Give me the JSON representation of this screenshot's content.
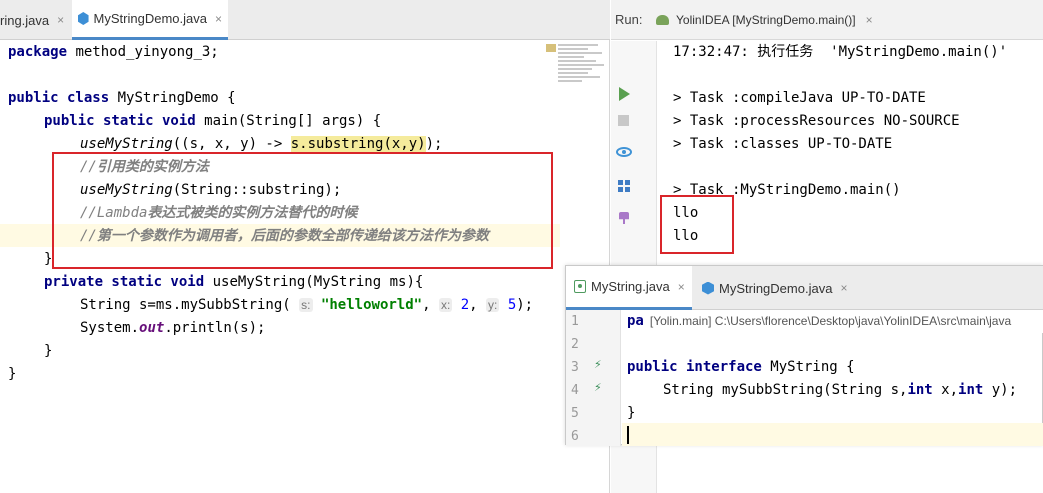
{
  "left_editor": {
    "tabs": [
      {
        "label": "ring.java",
        "close": "×"
      },
      {
        "label": "MyStringDemo.java",
        "close": "×"
      }
    ],
    "code": {
      "l1_kw": "package",
      "l1_rest": " method_yinyong_3;",
      "l3_kw": "public class",
      "l3_rest": " MyStringDemo {",
      "l4_kw": "public static void",
      "l4_rest": " main(String[] args) {",
      "l5_call": "useMyString",
      "l5_a": "((s, x, y) -> ",
      "l5_b": "s.substring(x,y)",
      "l5_c": ");",
      "l6_comment_a": "//",
      "l6_comment_b": "引用类的实例方法",
      "l7_call": "useMyString",
      "l7_rest": "(String::substring);",
      "l8_comment_a": "//Lambda",
      "l8_comment_b": "表达式被类的实例方法替代的时候",
      "l9_comment_a": "//",
      "l9_comment_b": "第一个参数作为调用者，后面的参数全部传递给该方法作为参数",
      "l10": "}",
      "l11_kw": "private static void",
      "l11_rest": " useMyString(MyString ms){",
      "l12_a": "String s=ms.mySubbString( ",
      "l12_hint_s": "s:",
      "l12_str": "\"helloworld\"",
      "l12_b": ", ",
      "l12_hint_x": "x:",
      "l12_num_x": "2",
      "l12_c": ", ",
      "l12_hint_y": "y:",
      "l12_num_y": "5",
      "l12_d": ");",
      "l13_a": "System.",
      "l13_out": "out",
      "l13_b": ".println(s);",
      "l14": "}",
      "l15": "}"
    }
  },
  "run_panel": {
    "label": "Run:",
    "tab_label": "YolinIDEA [MyStringDemo.main()]",
    "tab_close": "×",
    "console": [
      "17:32:47: 执行任务  'MyStringDemo.main()'",
      "",
      "> Task :compileJava UP-TO-DATE",
      "> Task :processResources NO-SOURCE",
      "> Task :classes UP-TO-DATE",
      "",
      "> Task :MyStringDemo.main()",
      "llo",
      "llo"
    ]
  },
  "popup_editor": {
    "tabs": [
      {
        "label": "MyString.java",
        "close": "×"
      },
      {
        "label": "MyStringDemo.java",
        "close": "×"
      }
    ],
    "breadcrumb_prefix": "pa",
    "breadcrumb": "[Yolin.main] C:\\Users\\florence\\Desktop\\java\\YolinIDEA\\src\\main\\java",
    "line_numbers": [
      "1",
      "2",
      "3",
      "4",
      "5",
      "6"
    ],
    "code": {
      "l3_kw": "public interface",
      "l3_rest": " MyString {",
      "l4_a": "String mySubbString(String s,",
      "l4_kw1": "int",
      "l4_b": " x,",
      "l4_kw2": "int",
      "l4_c": " y);",
      "l5": "}"
    }
  },
  "colors": {
    "keyword": "#000080",
    "comment": "#808080",
    "string": "#008000",
    "number": "#0000ff",
    "highlight_box": "#d9252a",
    "tab_underline": "#4a88c7"
  }
}
